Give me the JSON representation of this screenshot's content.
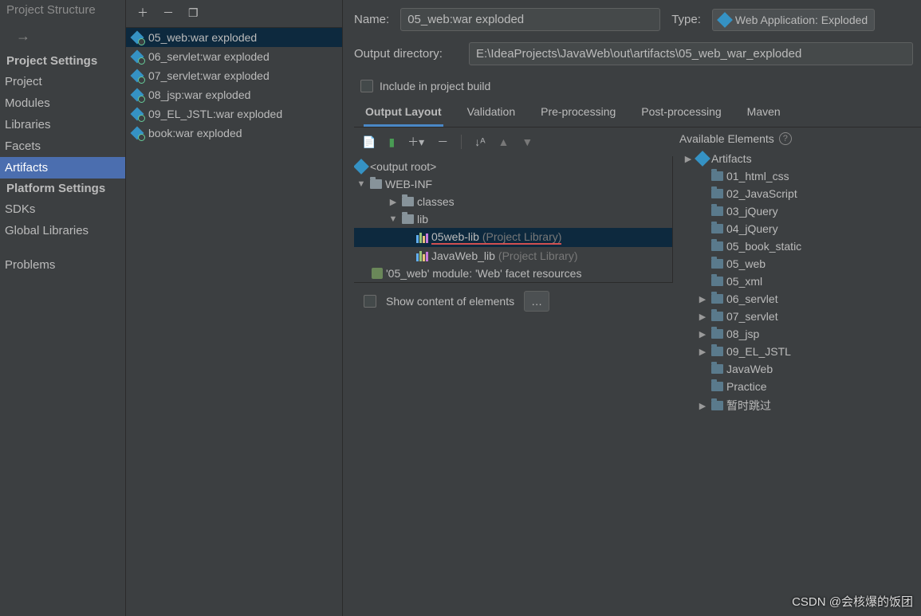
{
  "window": {
    "title": "Project Structure"
  },
  "sidebar": {
    "categories": [
      {
        "label": "Project Settings",
        "items": [
          "Project",
          "Modules",
          "Libraries",
          "Facets",
          "Artifacts"
        ]
      },
      {
        "label": "Platform Settings",
        "items": [
          "SDKs",
          "Global Libraries"
        ]
      },
      {
        "label": "",
        "items": [
          "Problems"
        ]
      }
    ],
    "selected": "Artifacts"
  },
  "artifacts": [
    "05_web:war exploded",
    "06_servlet:war exploded",
    "07_servlet:war exploded",
    "08_jsp:war exploded",
    "09_EL_JSTL:war exploded",
    "book:war exploded"
  ],
  "artifactSelected": 0,
  "form": {
    "nameLabel": "Name:",
    "nameValue": "05_web:war exploded",
    "typeLabel": "Type:",
    "typeValue": "Web Application: Exploded",
    "outDirLabel": "Output directory:",
    "outDirValue": "E:\\IdeaProjects\\JavaWeb\\out\\artifacts\\05_web_war_exploded",
    "includeLabel": "Include in project build"
  },
  "tabs": [
    "Output Layout",
    "Validation",
    "Pre-processing",
    "Post-processing",
    "Maven"
  ],
  "activeTab": 0,
  "outputTree": {
    "root": "<output root>",
    "webinf": "WEB-INF",
    "classes": "classes",
    "lib": "lib",
    "lib1": {
      "name": "05web-lib",
      "suffix": "(Project Library)"
    },
    "lib2": {
      "name": "JavaWeb_lib",
      "suffix": "(Project Library)"
    },
    "facet": "'05_web' module: 'Web' facet resources"
  },
  "available": {
    "title": "Available Elements",
    "artifacts": "Artifacts",
    "items": [
      {
        "label": "01_html_css",
        "expandable": false
      },
      {
        "label": "02_JavaScript",
        "expandable": false
      },
      {
        "label": "03_jQuery",
        "expandable": false
      },
      {
        "label": "04_jQuery",
        "expandable": false
      },
      {
        "label": "05_book_static",
        "expandable": false
      },
      {
        "label": "05_web",
        "expandable": false
      },
      {
        "label": "05_xml",
        "expandable": false
      },
      {
        "label": "06_servlet",
        "expandable": true
      },
      {
        "label": "07_servlet",
        "expandable": true
      },
      {
        "label": "08_jsp",
        "expandable": true
      },
      {
        "label": "09_EL_JSTL",
        "expandable": true
      },
      {
        "label": "JavaWeb",
        "expandable": false
      },
      {
        "label": "Practice",
        "expandable": false
      },
      {
        "label": "暂时跳过",
        "expandable": true
      }
    ]
  },
  "bottom": {
    "showContent": "Show content of elements"
  },
  "watermark": "CSDN @会核爆的饭团"
}
